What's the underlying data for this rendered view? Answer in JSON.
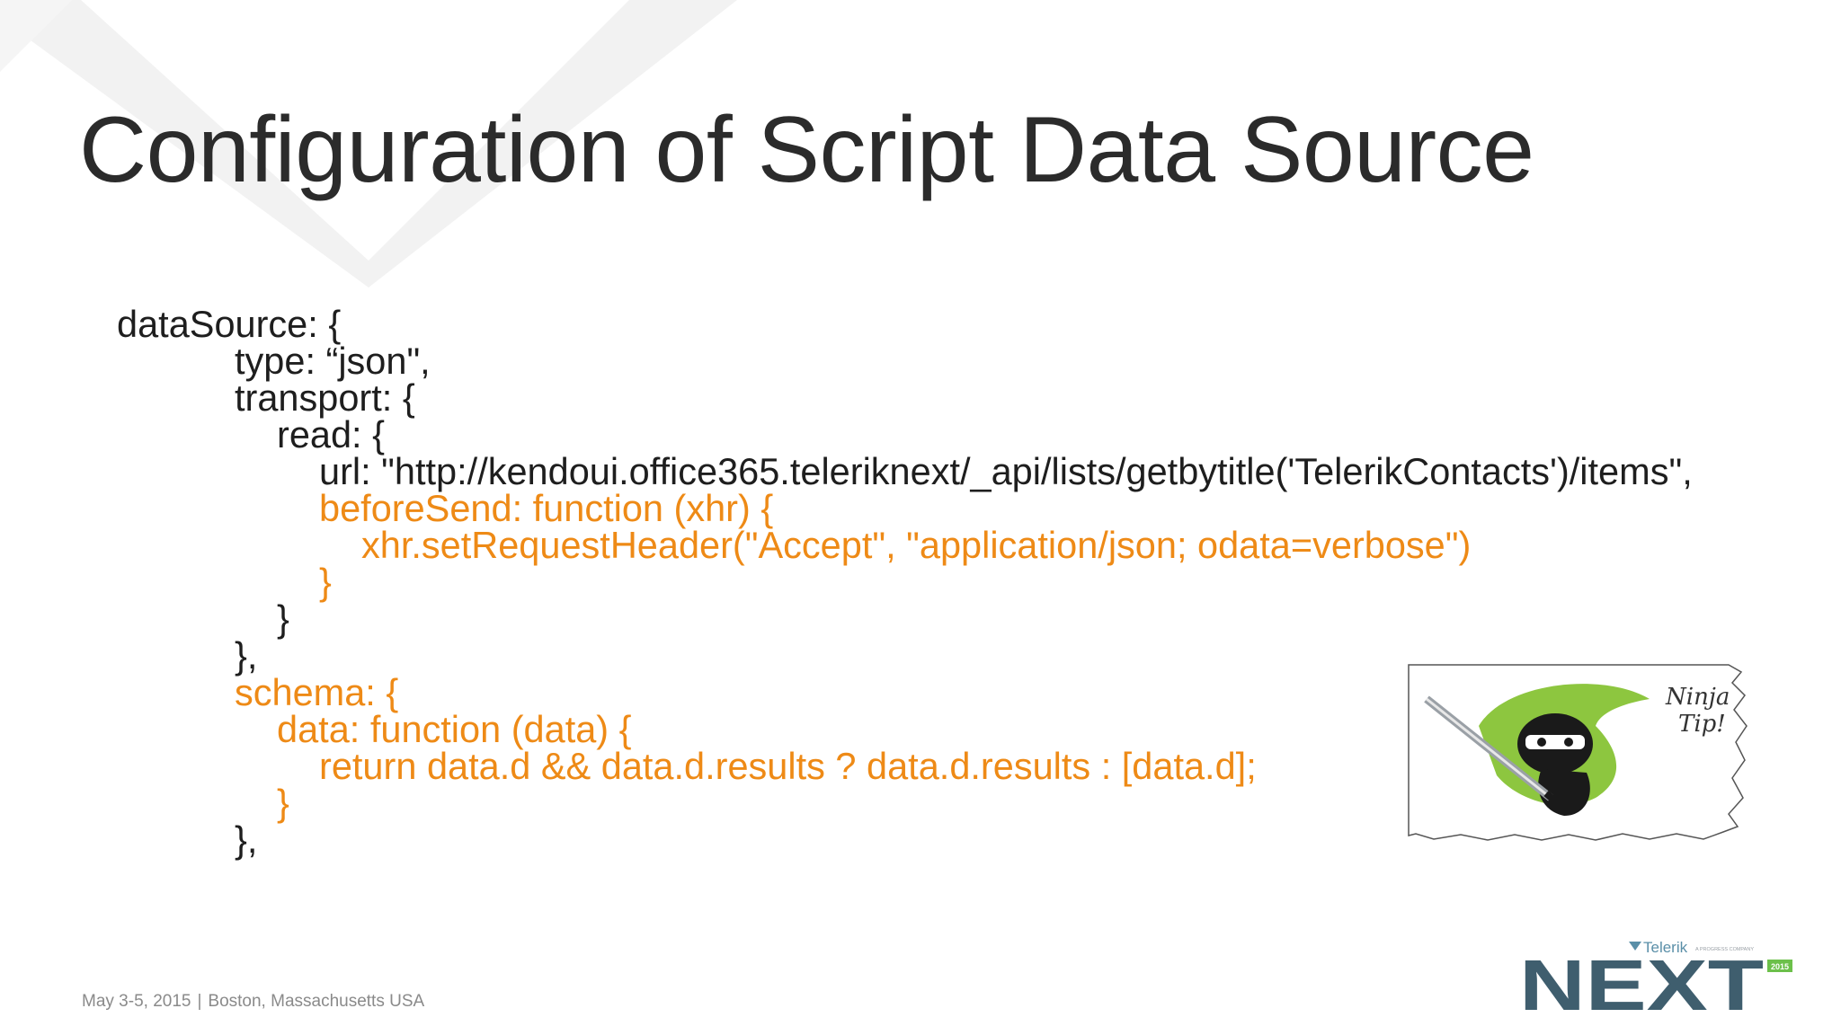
{
  "slide": {
    "title": "Configuration of Script Data Source",
    "code_lines": [
      {
        "text": "dataSource: {",
        "indent": 0,
        "highlight": false
      },
      {
        "text": "type: “json\",",
        "indent": 1,
        "highlight": false
      },
      {
        "text": "transport: {",
        "indent": 1,
        "highlight": false
      },
      {
        "text": "read: {",
        "indent": 2,
        "highlight": false
      },
      {
        "text": "url: \"http://kendoui.office365.teleriknext/_api/lists/getbytitle('TelerikContacts')/items\",",
        "indent": 3,
        "highlight": false
      },
      {
        "text": "beforeSend: function (xhr) {",
        "indent": 3,
        "highlight": true
      },
      {
        "text": "xhr.setRequestHeader(\"Accept\", \"application/json; odata=verbose\")",
        "indent": 4,
        "highlight": true
      },
      {
        "text": "}",
        "indent": 3,
        "highlight": true
      },
      {
        "text": "}",
        "indent": 2,
        "highlight": false
      },
      {
        "text": "},",
        "indent": 1,
        "highlight": false
      },
      {
        "text": "schema: {",
        "indent": 1,
        "highlight": true
      },
      {
        "text": "data: function (data) {",
        "indent": 2,
        "highlight": true
      },
      {
        "text": "return data.d && data.d.results ? data.d.results : [data.d];",
        "indent": 3,
        "highlight": true
      },
      {
        "text": "}",
        "indent": 2,
        "highlight": true
      },
      {
        "text": "},",
        "indent": 1,
        "highlight": false
      }
    ],
    "ninja_tip": {
      "label_line1": "Ninja",
      "label_line2": "Tip!",
      "icon": "ninja-icon"
    }
  },
  "footer": {
    "date": "May 3-5, 2015",
    "separator": "|",
    "location": "Boston, Massachusetts USA"
  },
  "branding": {
    "brand_name": "Telerik",
    "tagline": "A PROGRESS COMPANY",
    "logo_text": "NEXT",
    "year_badge": "2015"
  },
  "colors": {
    "title_text": "#2b2b2b",
    "code_text": "#1e1e1e",
    "code_highlight": "#ee8a16",
    "footer_text": "#8a8a8a",
    "background_chevron": "#f2f2f2",
    "ninja_green": "#8dc63f",
    "logo_teal": "#3f5e6e",
    "badge_green": "#6cc04a"
  }
}
